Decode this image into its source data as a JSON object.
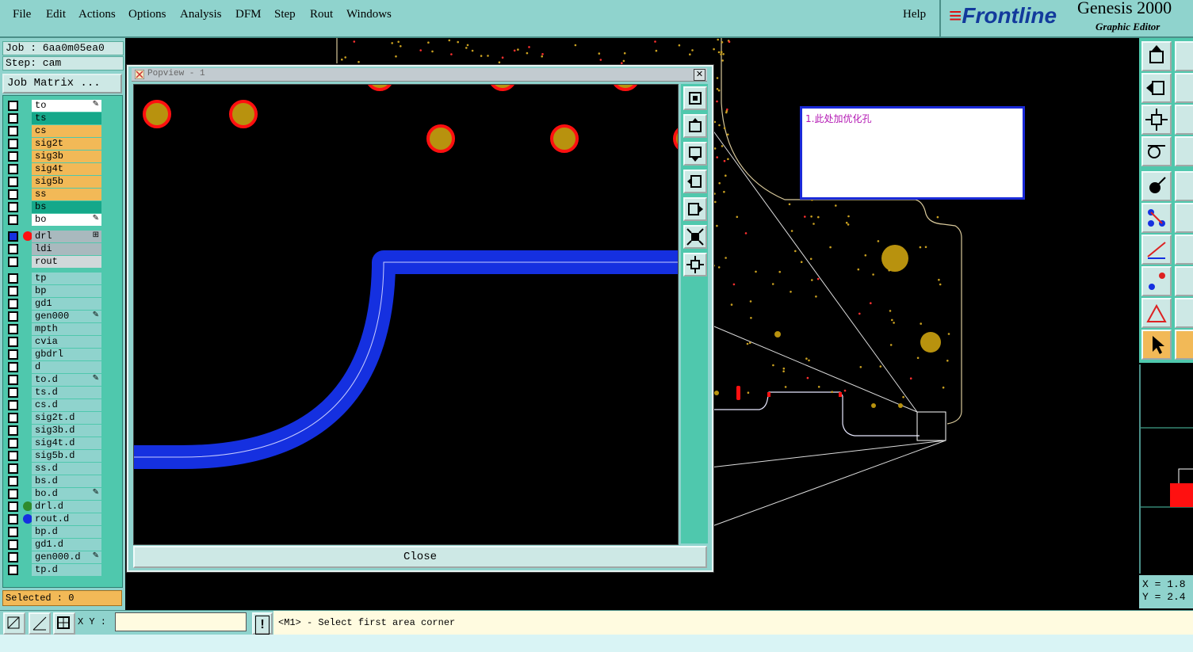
{
  "menubar": {
    "items": [
      "File",
      "Edit",
      "Actions",
      "Options",
      "Analysis",
      "DFM",
      "Step",
      "Rout",
      "Windows"
    ],
    "help": "Help"
  },
  "brand": {
    "logo": "Frontline",
    "title": "Genesis 2000",
    "subtitle": "Graphic Editor"
  },
  "job": {
    "job_label": "Job : 6aa0m05ea0",
    "step_label": "Step: cam",
    "matrix_button": "Job Matrix ..."
  },
  "layers": [
    {
      "name": "to",
      "color": "#ffffff",
      "mark": "✎"
    },
    {
      "name": "ts",
      "color": "#15a88a",
      "mark": ""
    },
    {
      "name": "cs",
      "color": "#f2b957",
      "mark": ""
    },
    {
      "name": "sig2t",
      "color": "#f2b957",
      "mark": ""
    },
    {
      "name": "sig3b",
      "color": "#f2b957",
      "mark": ""
    },
    {
      "name": "sig4t",
      "color": "#f2b957",
      "mark": ""
    },
    {
      "name": "sig5b",
      "color": "#f2b957",
      "mark": ""
    },
    {
      "name": "ss",
      "color": "#f2b957",
      "mark": ""
    },
    {
      "name": "bs",
      "color": "#15a88a",
      "mark": ""
    },
    {
      "name": "bo",
      "color": "#ffffff",
      "mark": "✎"
    },
    {
      "name": "drl",
      "color": "#a9b9be",
      "mark": "⊞",
      "dot": "#ff1010",
      "active": true
    },
    {
      "name": "ldi",
      "color": "#a9b9be",
      "mark": ""
    },
    {
      "name": "rout",
      "color": "#d0d8da",
      "mark": ""
    },
    {
      "name": "tp",
      "color": "#8fd3cd",
      "mark": ""
    },
    {
      "name": "bp",
      "color": "#8fd3cd",
      "mark": ""
    },
    {
      "name": "gd1",
      "color": "#8fd3cd",
      "mark": ""
    },
    {
      "name": "gen000",
      "color": "#8fd3cd",
      "mark": "✎"
    },
    {
      "name": "mpth",
      "color": "#8fd3cd",
      "mark": ""
    },
    {
      "name": "cvia",
      "color": "#8fd3cd",
      "mark": ""
    },
    {
      "name": "gbdrl",
      "color": "#8fd3cd",
      "mark": ""
    },
    {
      "name": "d",
      "color": "#8fd3cd",
      "mark": ""
    },
    {
      "name": "to.d",
      "color": "#8fd3cd",
      "mark": "✎"
    },
    {
      "name": "ts.d",
      "color": "#8fd3cd",
      "mark": ""
    },
    {
      "name": "cs.d",
      "color": "#8fd3cd",
      "mark": ""
    },
    {
      "name": "sig2t.d",
      "color": "#8fd3cd",
      "mark": ""
    },
    {
      "name": "sig3b.d",
      "color": "#8fd3cd",
      "mark": ""
    },
    {
      "name": "sig4t.d",
      "color": "#8fd3cd",
      "mark": ""
    },
    {
      "name": "sig5b.d",
      "color": "#8fd3cd",
      "mark": ""
    },
    {
      "name": "ss.d",
      "color": "#8fd3cd",
      "mark": ""
    },
    {
      "name": "bs.d",
      "color": "#8fd3cd",
      "mark": ""
    },
    {
      "name": "bo.d",
      "color": "#8fd3cd",
      "mark": "✎"
    },
    {
      "name": "drl.d",
      "color": "#8fd3cd",
      "mark": "",
      "dot": "#2e8b2e"
    },
    {
      "name": "rout.d",
      "color": "#8fd3cd",
      "mark": "",
      "dot": "#1530e0"
    },
    {
      "name": "bp.d",
      "color": "#8fd3cd",
      "mark": ""
    },
    {
      "name": "gd1.d",
      "color": "#8fd3cd",
      "mark": ""
    },
    {
      "name": "gen000.d",
      "color": "#8fd3cd",
      "mark": "✎"
    },
    {
      "name": "tp.d",
      "color": "#8fd3cd",
      "mark": ""
    }
  ],
  "selected": "Selected : 0",
  "popview": {
    "title": "Popview - 1",
    "close_button": "Close"
  },
  "annotation": {
    "text": "1.此处加优化孔"
  },
  "coords": {
    "x": "X = 1.8",
    "y": "Y = 2.4"
  },
  "bottombar": {
    "xy_label": "X Y :",
    "xy_value": "",
    "warn": "!",
    "status": "<M1> - Select first area corner"
  },
  "colors": {
    "panel": "#8fd3cd",
    "accent": "#4fc8ad",
    "rout": "#1530e0",
    "pad": "#b8920e",
    "pad_ring": "#ff1010"
  }
}
